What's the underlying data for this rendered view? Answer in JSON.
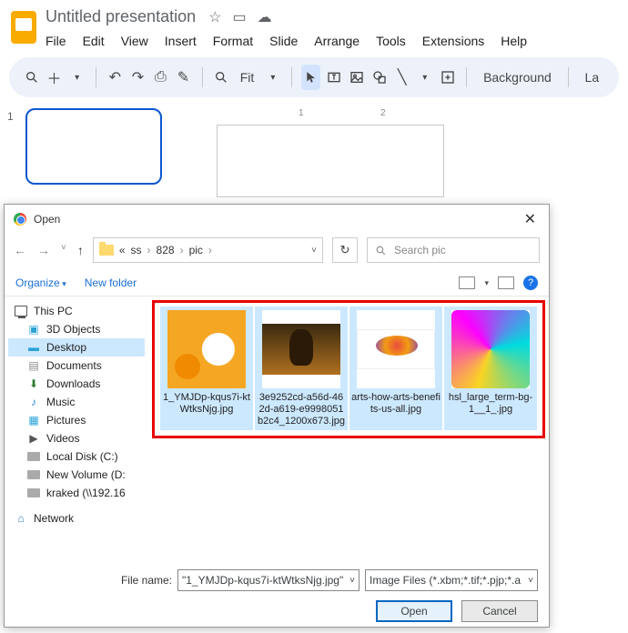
{
  "doc": {
    "title": "Untitled presentation"
  },
  "menu": [
    "File",
    "Edit",
    "View",
    "Insert",
    "Format",
    "Slide",
    "Arrange",
    "Tools",
    "Extensions",
    "Help"
  ],
  "toolbar": {
    "fit": "Fit",
    "background": "Background",
    "layout_short": "La"
  },
  "thumb": {
    "num": "1"
  },
  "ruler": {
    "t1": "1",
    "t2": "2"
  },
  "dialog": {
    "title": "Open",
    "path": {
      "prefix": "«",
      "p1": "ss",
      "p2": "828",
      "p3": "pic"
    },
    "search_placeholder": "Search pic",
    "organize": "Organize",
    "newfolder": "New folder",
    "sidebar": {
      "thispc": "This PC",
      "objects3d": "3D Objects",
      "desktop": "Desktop",
      "documents": "Documents",
      "downloads": "Downloads",
      "music": "Music",
      "pictures": "Pictures",
      "videos": "Videos",
      "localc": "Local Disk (C:)",
      "newvol": "New Volume (D:",
      "kraked": "kraked (\\\\192.16",
      "network": "Network"
    },
    "files": [
      {
        "name": "1_YMJDp-kqus7i-ktWtksNjg.jpg"
      },
      {
        "name": "3e9252cd-a56d-462d-a619-e999805​1b2c4_1200x673.jpg"
      },
      {
        "name": "arts-how-arts-benefits-us-all.jpg"
      },
      {
        "name": "hsl_large_term-bg-1__1_.jpg"
      }
    ],
    "filename_label": "File name:",
    "filename_value": "\"1_YMJDp-kqus7i-ktWtksNjg.jpg\"",
    "filter": "Image Files (*.xbm;*.tif;*.pjp;*.a",
    "open_btn": "Open",
    "cancel_btn": "Cancel"
  }
}
